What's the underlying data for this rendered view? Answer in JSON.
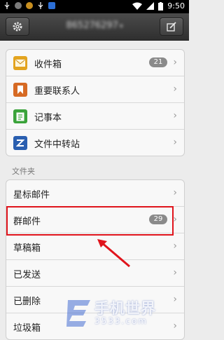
{
  "status_bar": {
    "time": "9:50",
    "icons": [
      "usb-icon",
      "app-icon",
      "app-icon",
      "usb-icon",
      "wifi-icon",
      "signal-icon",
      "battery-icon"
    ]
  },
  "header": {
    "account": "865276297",
    "left_icon": "gear-icon",
    "right_icon": "compose-icon"
  },
  "main_items": [
    {
      "label": "收件箱",
      "icon": "envelope-icon",
      "badge": "21",
      "color": "#e3a41f"
    },
    {
      "label": "重要联系人",
      "icon": "bookmark-icon",
      "badge": "",
      "color": "#d66a24"
    },
    {
      "label": "记事本",
      "icon": "note-icon",
      "badge": "",
      "color": "#3aa33a"
    },
    {
      "label": "文件中转站",
      "icon": "transfer-icon",
      "badge": "",
      "color": "#2a5fb0"
    }
  ],
  "folders_label": "文件夹",
  "folders": [
    {
      "label": "星标邮件",
      "badge": ""
    },
    {
      "label": "群邮件",
      "badge": "29"
    },
    {
      "label": "草稿箱",
      "badge": ""
    },
    {
      "label": "已发送",
      "badge": ""
    },
    {
      "label": "已删除",
      "badge": ""
    },
    {
      "label": "垃圾箱",
      "badge": ""
    }
  ],
  "watermark": {
    "text": "手机世界",
    "sub": "3533.com"
  },
  "annotation_color": "#e0141c"
}
